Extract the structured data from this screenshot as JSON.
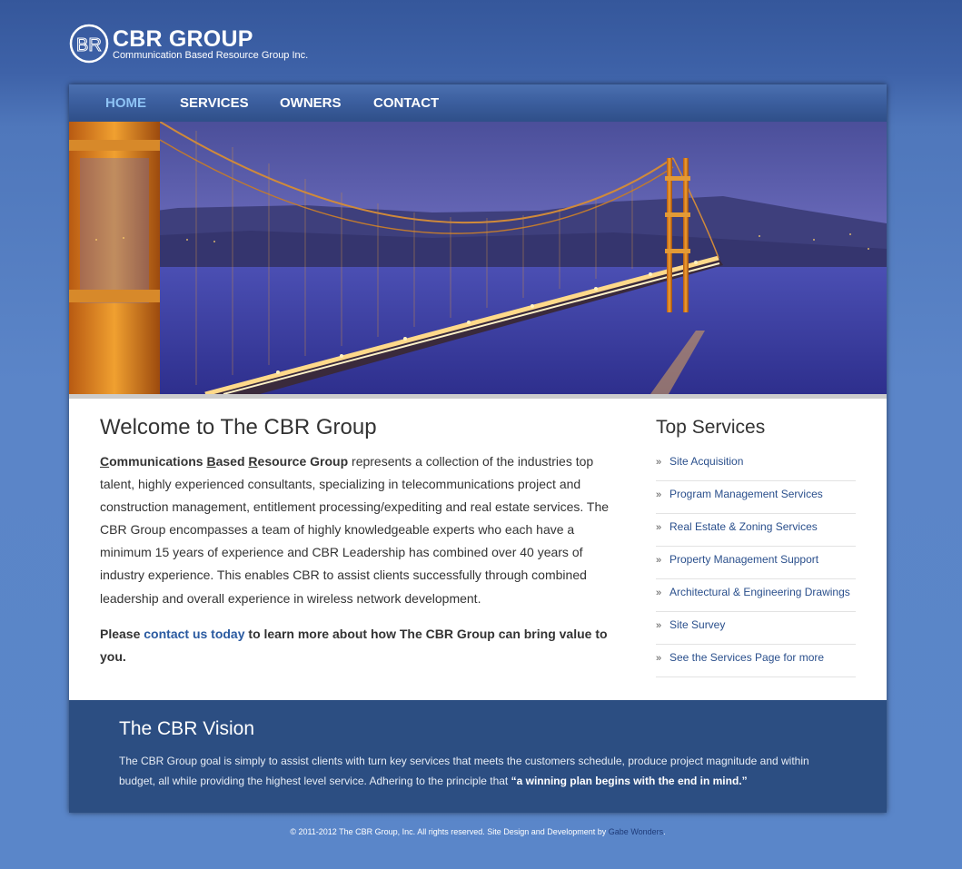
{
  "header": {
    "logo_title": "CBR GROUP",
    "logo_subtitle": "Communication Based Resource Group Inc."
  },
  "nav": {
    "items": [
      {
        "label": "HOME",
        "active": true
      },
      {
        "label": "SERVICES",
        "active": false
      },
      {
        "label": "OWNERS",
        "active": false
      },
      {
        "label": "CONTACT",
        "active": false
      }
    ]
  },
  "main": {
    "title": "Welcome to The CBR Group",
    "intro_name": {
      "c": "C",
      "ommunications ": "ommunications ",
      "b": "B",
      "ased ": "ased ",
      "r": "R",
      "esource ": "esource Group"
    },
    "intro_text": " represents a collection of the industries top talent, highly experienced consultants, specializing in telecommunications project and construction management, entitlement processing/expediting and real estate services. The CBR Group encompasses a team of highly knowledgeable experts who each have a minimum 15 years of experience and CBR Leadership has combined over 40 years of industry experience. This enables CBR to assist clients successfully through combined leadership and overall experience in wireless network development.",
    "cta_prefix": "Please ",
    "cta_link": "contact us today",
    "cta_suffix": " to learn more about how The CBR Group can bring value to you."
  },
  "sidebar": {
    "title": "Top Services",
    "bullet": "»",
    "items": [
      "Site Acquisition",
      "Program Management Services",
      "Real Estate & Zoning Services",
      "Property Management Support",
      "Architectural & Engineering Drawings",
      "Site Survey",
      "See the Services Page for more"
    ]
  },
  "vision": {
    "title": "The CBR Vision",
    "text": "The CBR Group goal is simply to assist clients with turn key services that meets the customers schedule, produce project magnitude and within budget, all while providing the highest level service. Adhering to the principle that ",
    "quote": "“a winning plan begins with the end in mind.”"
  },
  "footer": {
    "text": "© 2011-2012 The CBR Group, Inc. All rights reserved. Site Design and Development by ",
    "link": "Gabe Wonders",
    "end": "."
  }
}
